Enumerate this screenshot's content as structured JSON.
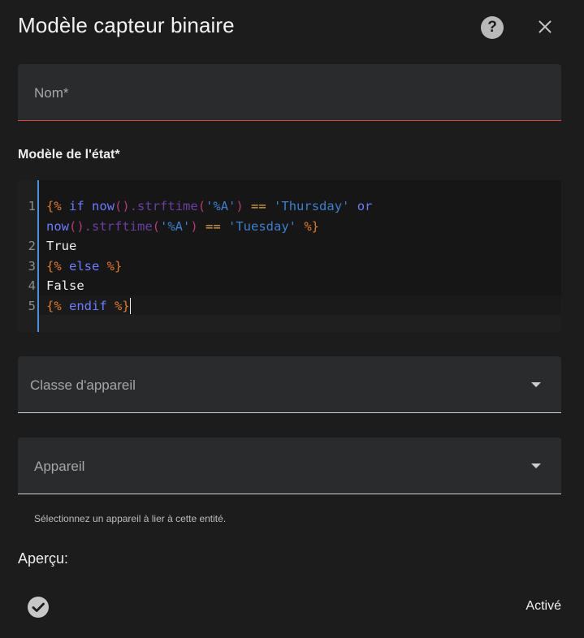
{
  "dialog": {
    "title": "Modèle capteur binaire",
    "help_icon": "help-circle-icon",
    "close_icon": "close-icon"
  },
  "name_field": {
    "label": "Nom*"
  },
  "state_template": {
    "label": "Modèle de l'état*",
    "lines": [
      {
        "num": "1",
        "tokens": [
          {
            "t": "{%",
            "c": "t-delim"
          },
          {
            "t": " ",
            "c": "t-plain"
          },
          {
            "t": "if",
            "c": "t-kw"
          },
          {
            "t": " ",
            "c": "t-plain"
          },
          {
            "t": "now",
            "c": "t-fn"
          },
          {
            "t": "()",
            "c": "t-paren"
          },
          {
            "t": ".strftime",
            "c": "t-attr"
          },
          {
            "t": "(",
            "c": "t-paren"
          },
          {
            "t": "'%A'",
            "c": "t-str"
          },
          {
            "t": ")",
            "c": "t-paren"
          },
          {
            "t": " == ",
            "c": "t-op"
          },
          {
            "t": "'Thursday'",
            "c": "t-str"
          },
          {
            "t": " or",
            "c": "t-kw"
          }
        ]
      },
      {
        "num": "",
        "tokens": [
          {
            "t": "now",
            "c": "t-fn"
          },
          {
            "t": "()",
            "c": "t-paren"
          },
          {
            "t": ".strftime",
            "c": "t-attr"
          },
          {
            "t": "(",
            "c": "t-paren"
          },
          {
            "t": "'%A'",
            "c": "t-str"
          },
          {
            "t": ")",
            "c": "t-paren"
          },
          {
            "t": " == ",
            "c": "t-op"
          },
          {
            "t": "'Tuesday'",
            "c": "t-str"
          },
          {
            "t": " %}",
            "c": "t-delim"
          }
        ]
      },
      {
        "num": "2",
        "tokens": [
          {
            "t": "True",
            "c": "t-plain"
          }
        ]
      },
      {
        "num": "3",
        "tokens": [
          {
            "t": "{%",
            "c": "t-delim"
          },
          {
            "t": " else ",
            "c": "t-kw"
          },
          {
            "t": "%}",
            "c": "t-delim"
          }
        ]
      },
      {
        "num": "4",
        "tokens": [
          {
            "t": "False",
            "c": "t-plain"
          }
        ]
      },
      {
        "num": "5",
        "tokens": [
          {
            "t": "{%",
            "c": "t-delim"
          },
          {
            "t": " endif ",
            "c": "t-kw"
          },
          {
            "t": "%}",
            "c": "t-delim"
          }
        ]
      }
    ]
  },
  "device_class_field": {
    "label": "Classe d'appareil",
    "icon": "chevron-down-icon"
  },
  "device_field": {
    "label": "Appareil",
    "icon": "chevron-down-icon",
    "helper": "Sélectionnez un appareil à lier à cette entité."
  },
  "preview": {
    "title": "Aperçu:",
    "icon": "check-circle-icon",
    "state": "Activé"
  },
  "colors": {
    "background": "#1c1c1c",
    "field": "#2a2b2d",
    "error": "#d74a3c",
    "accent": "#4f8ed8"
  }
}
